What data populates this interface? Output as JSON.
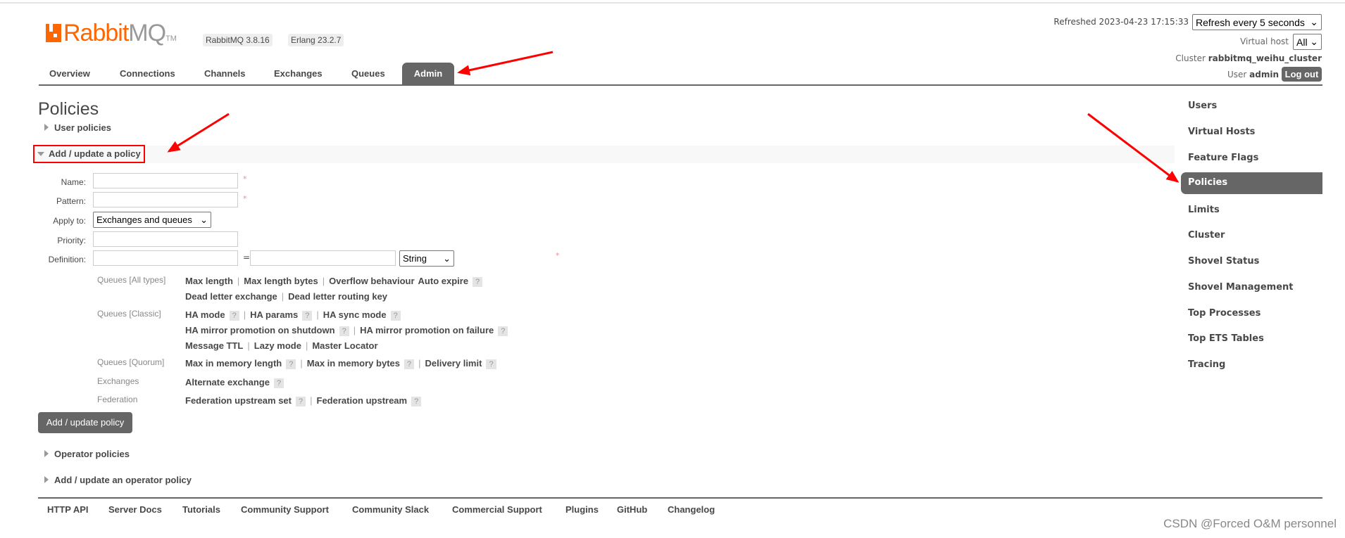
{
  "header": {
    "logo_text": "RabbitMQ",
    "logo_tm": "TM",
    "version_badge": "RabbitMQ 3.8.16",
    "erlang_badge": "Erlang 23.2.7",
    "refreshed": "Refreshed 2023-04-23 17:15:33",
    "refresh_select": "Refresh every 5 seconds",
    "vhost_label": "Virtual host",
    "vhost_select": "All",
    "cluster_label": "Cluster",
    "cluster_name": "rabbitmq_weihu_cluster",
    "user_label": "User",
    "user_name": "admin",
    "logout": "Log out"
  },
  "nav": {
    "tabs": [
      "Overview",
      "Connections",
      "Channels",
      "Exchanges",
      "Queues",
      "Admin"
    ],
    "active": "Admin"
  },
  "main": {
    "title": "Policies",
    "user_policies": "User policies",
    "add_section": "Add / update a policy",
    "form": {
      "name_label": "Name:",
      "pattern_label": "Pattern:",
      "apply_label": "Apply to:",
      "apply_value": "Exchanges and queues",
      "priority_label": "Priority:",
      "definition_label": "Definition:",
      "equals": "=",
      "type_value": "String",
      "required": "*",
      "name_value": "",
      "pattern_value": "",
      "priority_value": "",
      "def_key": "",
      "def_value": ""
    },
    "help": [
      {
        "category": "Queues [All types]",
        "lines": [
          [
            {
              "t": "Max length"
            },
            {
              "t": "Max length bytes"
            },
            {
              "t": "Overflow behaviour",
              "nosep": true
            },
            {
              "t": "Auto expire",
              "q": true
            }
          ],
          [
            {
              "t": "Dead letter exchange"
            },
            {
              "t": "Dead letter routing key"
            }
          ]
        ]
      },
      {
        "category": "Queues [Classic]",
        "lines": [
          [
            {
              "t": "HA mode",
              "q": true
            },
            {
              "t": "HA params",
              "q": true
            },
            {
              "t": "HA sync mode",
              "q": true
            }
          ],
          [
            {
              "t": "HA mirror promotion on shutdown",
              "q": true
            },
            {
              "t": "HA mirror promotion on failure",
              "q": true
            }
          ],
          [
            {
              "t": "Message TTL"
            },
            {
              "t": "Lazy mode"
            },
            {
              "t": "Master Locator"
            }
          ]
        ]
      },
      {
        "category": "Queues [Quorum]",
        "lines": [
          [
            {
              "t": "Max in memory length",
              "q": true
            },
            {
              "t": "Max in memory bytes",
              "q": true
            },
            {
              "t": "Delivery limit",
              "q": true
            }
          ]
        ]
      },
      {
        "category": "Exchanges",
        "lines": [
          [
            {
              "t": "Alternate exchange",
              "q": true
            }
          ]
        ]
      },
      {
        "category": "Federation",
        "lines": [
          [
            {
              "t": "Federation upstream set",
              "q": true
            },
            {
              "t": "Federation upstream",
              "q": true
            }
          ]
        ]
      }
    ],
    "help_icon": "?",
    "submit": "Add / update policy",
    "operator_policies": "Operator policies",
    "add_operator": "Add / update an operator policy"
  },
  "sidebar": {
    "items": [
      "Users",
      "Virtual Hosts",
      "Feature Flags",
      "Policies",
      "Limits",
      "Cluster",
      "Shovel Status",
      "Shovel Management",
      "Top Processes",
      "Top ETS Tables",
      "Tracing"
    ],
    "active": "Policies"
  },
  "footer": {
    "links": [
      "HTTP API",
      "Server Docs",
      "Tutorials",
      "Community Support",
      "Community Slack",
      "Commercial Support",
      "Plugins",
      "GitHub",
      "Changelog"
    ]
  },
  "watermark": "CSDN @Forced O&M personnel",
  "colors": {
    "brand": "#ff6600",
    "active_tab": "#666666",
    "annotation": "#ff0000"
  }
}
